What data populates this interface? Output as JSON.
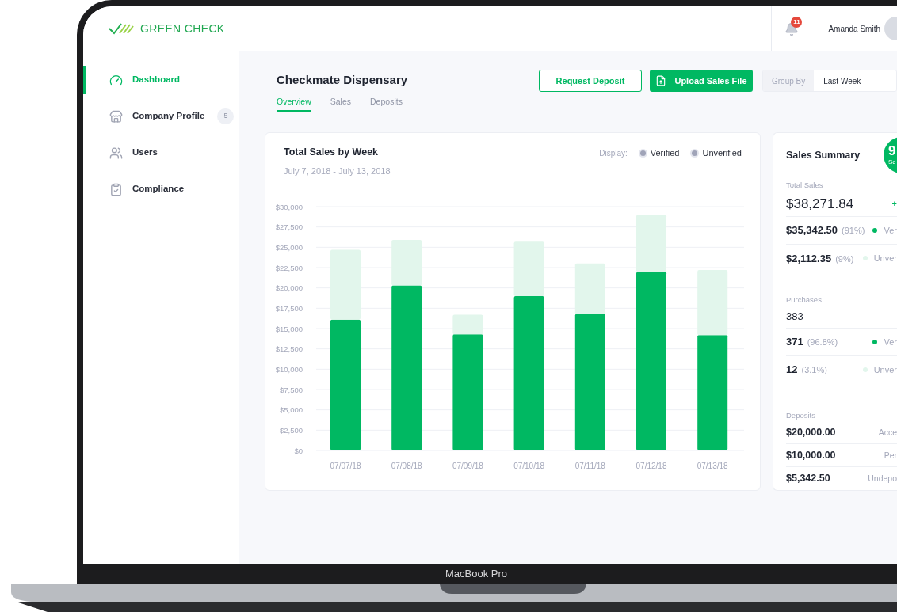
{
  "app": {
    "logo": "GREEN CHECK"
  },
  "header": {
    "notifications": "11",
    "user": "Amanda Smith"
  },
  "sidebar": {
    "items": [
      {
        "label": "Dashboard",
        "selected": true,
        "kind": "gauge"
      },
      {
        "label": "Company Profile",
        "selected": false,
        "kind": "store",
        "badge": "5"
      },
      {
        "label": "Users",
        "selected": false,
        "kind": "users"
      },
      {
        "label": "Compliance",
        "selected": false,
        "kind": "clipboard"
      }
    ]
  },
  "page": {
    "title": "Checkmate Dispensary",
    "tabs": [
      {
        "label": "Overview",
        "selected": true
      },
      {
        "label": "Sales",
        "selected": false
      },
      {
        "label": "Deposits",
        "selected": false
      }
    ],
    "buttons": [
      {
        "label": "Request Deposit",
        "kind": "outline"
      },
      {
        "label": "Upload Sales File",
        "kind": "primary"
      }
    ],
    "group_by": {
      "label": "Group By",
      "value": "Last Week"
    }
  },
  "chart_card": {
    "title": "Total Sales by Week",
    "subtitle": "July 7, 2018 - July 13, 2018",
    "display_label": "Display:",
    "chart_data": {
      "type": "bar",
      "stacked": true,
      "grid": true,
      "categories": [
        "07/07/18",
        "07/08/18",
        "07/09/18",
        "07/10/18",
        "07/11/18",
        "07/12/18",
        "07/13/18"
      ],
      "series": [
        {
          "name": "Verified",
          "color": "#00b862",
          "values": [
            16100,
            20300,
            14300,
            19000,
            16800,
            22000,
            14200
          ]
        },
        {
          "name": "Unverified",
          "color": "#e2f6ec",
          "values": [
            8600,
            5600,
            2400,
            6700,
            6200,
            7000,
            8000
          ]
        }
      ],
      "ylim": [
        0,
        30000
      ],
      "yticks": [
        {
          "value": 0,
          "label": "$0"
        },
        {
          "value": 2500,
          "label": "$2,500"
        },
        {
          "value": 5000,
          "label": "$5,000"
        },
        {
          "value": 7500,
          "label": "$7,500"
        },
        {
          "value": 10000,
          "label": "$10,000"
        },
        {
          "value": 12500,
          "label": "$12,500"
        },
        {
          "value": 15000,
          "label": "$15,000"
        },
        {
          "value": 17500,
          "label": "$17,500"
        },
        {
          "value": 20000,
          "label": "$20,000"
        },
        {
          "value": 22500,
          "label": "$22,500"
        },
        {
          "value": 25000,
          "label": "$25,000"
        },
        {
          "value": 27500,
          "label": "$27,500"
        },
        {
          "value": 30000,
          "label": "$30,000"
        }
      ]
    }
  },
  "summary": {
    "title": "Sales Summary",
    "score": {
      "value": "9",
      "label": "Sc"
    },
    "total_sales": {
      "label": "Total Sales",
      "value": "$38,271.84",
      "change": "+"
    },
    "sales_rows": [
      {
        "amount": "$35,342.50",
        "share": "(91%)",
        "color": "#00b862",
        "status": "Ver"
      },
      {
        "amount": "$2,112.35",
        "share": "(9%)",
        "color": "#e2f6ec",
        "status": "Unver"
      }
    ],
    "purchases": {
      "label": "Purchases",
      "value": "383"
    },
    "purchase_rows": [
      {
        "amount": "371",
        "share": "(96.8%)",
        "color": "#00b862",
        "status": "Ver"
      },
      {
        "amount": "12",
        "share": "(3.1%)",
        "color": "#e2f6ec",
        "status": "Unver"
      }
    ],
    "deposits": {
      "label": "Deposits",
      "rows": [
        {
          "amount": "$20,000.00",
          "status": "Acce"
        },
        {
          "amount": "$10,000.00",
          "status": "Per"
        },
        {
          "amount": "$5,342.50",
          "status": "Undepo"
        }
      ]
    }
  },
  "device": {
    "label": "MacBook Pro"
  }
}
